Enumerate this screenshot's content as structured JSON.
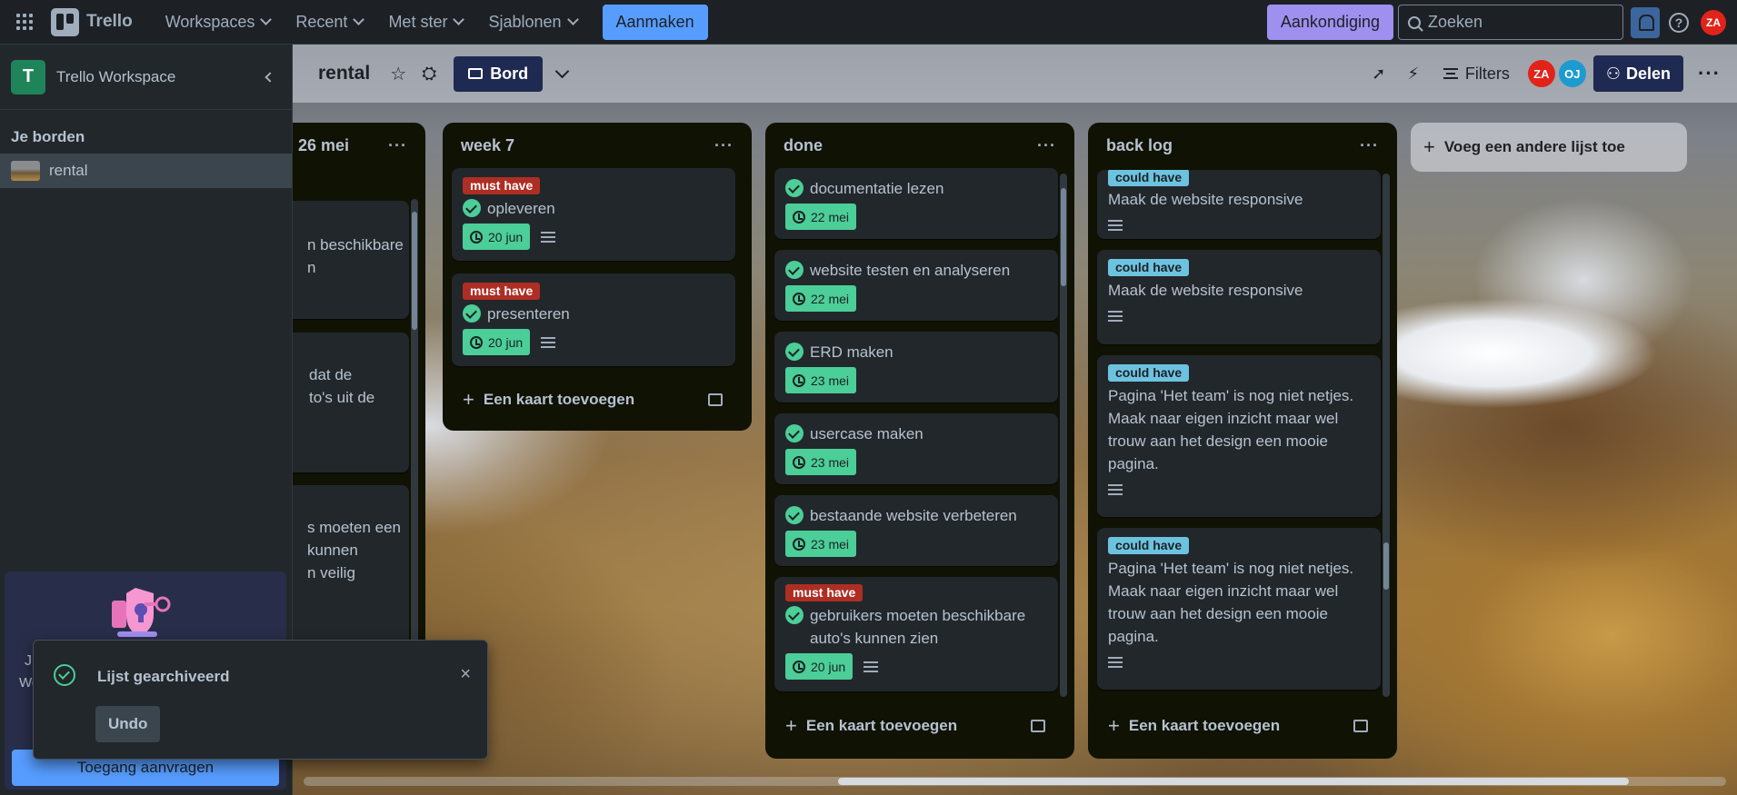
{
  "topbar": {
    "app_name": "Trello",
    "menu": [
      {
        "label": "Workspaces"
      },
      {
        "label": "Recent"
      },
      {
        "label": "Met ster"
      },
      {
        "label": "Sjablonen"
      }
    ],
    "create_label": "Aanmaken",
    "announce_label": "Aankondiging",
    "search_placeholder": "Zoeken",
    "avatar_initials": "ZA",
    "colors": {
      "bg": "#1d2125",
      "accent": "#579dff",
      "announce": "#9f8fef",
      "avatar": "#e2231a"
    }
  },
  "sidebar": {
    "workspace_letter": "T",
    "workspace_name": "Trello Workspace",
    "boards_title": "Je borden",
    "boards": [
      {
        "label": "rental"
      }
    ],
    "promo_text_1": "J",
    "promo_text_2": "We",
    "promo_button": "Toegang aanvragen"
  },
  "board": {
    "title": "rental",
    "view_label": "Bord",
    "filters_label": "Filters",
    "members": [
      {
        "initials": "ZA",
        "color": "#e2231a"
      },
      {
        "initials": "OJ",
        "color": "#1d9bd1"
      }
    ],
    "share_label": "Delen",
    "more": "···",
    "add_list_label": "Voeg een andere lijst toe"
  },
  "lists": [
    {
      "title": "26 mei",
      "cards_partial": [
        {
          "lines": [
            "n beschikbare",
            "n"
          ]
        },
        {
          "lines": [
            "dat de",
            "to's uit de"
          ]
        },
        {
          "lines": [
            "s moeten een",
            "kunnen",
            "n veilig"
          ]
        }
      ]
    },
    {
      "title": "week 7",
      "add_card_label": "Een kaart toevoegen",
      "cards": [
        {
          "label": "must have",
          "title": "opleveren",
          "due": "20 jun"
        },
        {
          "label": "must have",
          "title": "presenteren",
          "due": "20 jun"
        }
      ]
    },
    {
      "title": "done",
      "add_card_label": "Een kaart toevoegen",
      "cards": [
        {
          "title": "documentatie lezen",
          "due": "22 mei"
        },
        {
          "title": "website testen en analyseren",
          "due": "22 mei"
        },
        {
          "title": "ERD maken",
          "due": "23 mei"
        },
        {
          "title": "usercase maken",
          "due": "23 mei"
        },
        {
          "title": "bestaande website verbeteren",
          "due": "23 mei"
        },
        {
          "label": "must have",
          "title": "gebruikers moeten beschikbare auto's kunnen zien",
          "due": "20 jun"
        }
      ]
    },
    {
      "title": "back log",
      "add_card_label": "Een kaart toevoegen",
      "cards": [
        {
          "label": "could have",
          "title": "Maak de website responsive"
        },
        {
          "label": "could have",
          "title": "Maak de website responsive"
        },
        {
          "label": "could have",
          "title": "Pagina 'Het team' is nog niet netjes. Maak naar eigen inzicht maar wel trouw aan het design een mooie pagina."
        },
        {
          "label": "could have",
          "title": "Pagina 'Het team' is nog niet netjes. Maak naar eigen inzicht maar wel trouw aan het design een mooie pagina."
        }
      ]
    }
  ],
  "toast": {
    "title": "Lijst gearchiveerd",
    "undo_label": "Undo",
    "close": "×"
  },
  "icons": [
    "apps-grid-icon",
    "chevron-down-icon",
    "search-icon",
    "bell-icon",
    "help-icon",
    "chevron-left-icon",
    "star-icon",
    "visibility-icon",
    "board-view-icon",
    "rocket-icon",
    "automation-icon",
    "filter-icon",
    "share-icon",
    "check-icon",
    "clock-icon",
    "description-icon",
    "plus-icon",
    "template-icon",
    "close-icon"
  ]
}
